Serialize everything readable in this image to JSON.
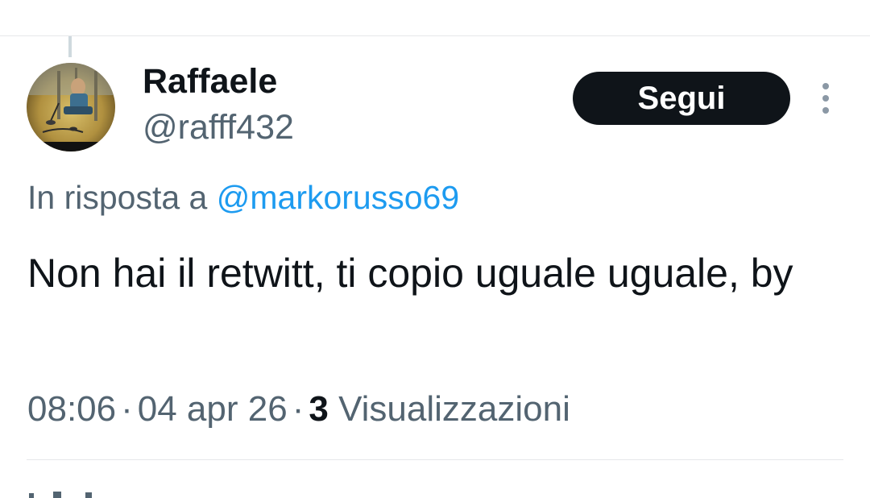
{
  "tweet": {
    "author": {
      "display_name": "Raffaele",
      "handle": "@rafff432",
      "avatar": "avatar-image"
    },
    "follow_button_label": "Segui",
    "more_icon": "more-vertical-icon",
    "reply_prefix": "In risposta a",
    "reply_mention": "@markorusso69",
    "text": "Non hai il retwitt, ti copio uguale uguale, by",
    "meta": {
      "time": "08:06",
      "date": "04 apr 26",
      "views_count": "3",
      "views_label": "Visualizzazioni"
    }
  },
  "colors": {
    "text_primary": "#0f1419",
    "text_secondary": "#536471",
    "link": "#1d9bf0",
    "button_bg": "#0f1419",
    "divider": "#e6e8ea"
  }
}
